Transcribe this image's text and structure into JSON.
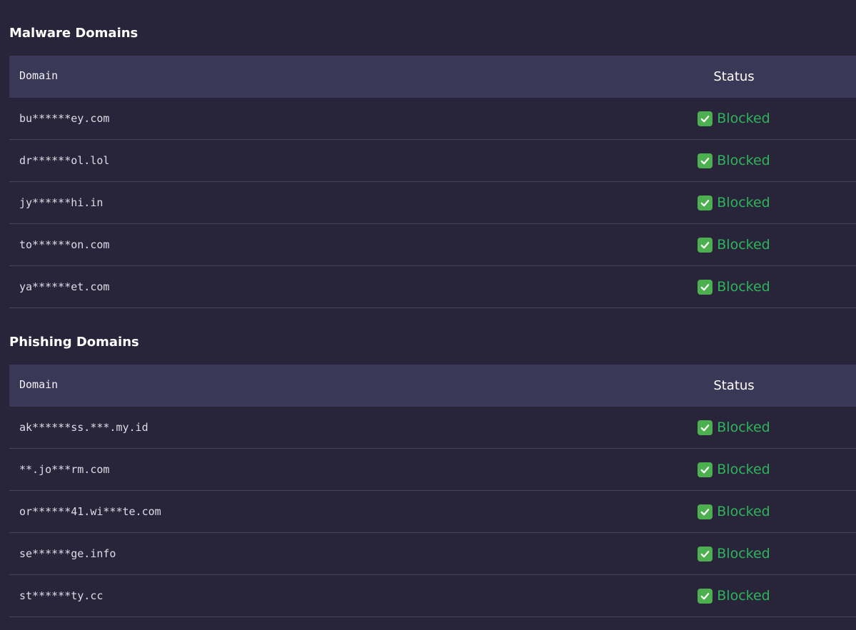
{
  "colors": {
    "background": "#28253a",
    "header_row": "#3b3857",
    "row_divider": "#46435c",
    "status_green": "#2fb35a",
    "check_green": "#4caf50"
  },
  "sections": [
    {
      "title": "Malware Domains",
      "columns": {
        "domain": "Domain",
        "status": "Status"
      },
      "rows": [
        {
          "domain": "bu******ey.com",
          "status": "Blocked",
          "icon": "check-mark-icon"
        },
        {
          "domain": "dr******ol.lol",
          "status": "Blocked",
          "icon": "check-mark-icon"
        },
        {
          "domain": "jy******hi.in",
          "status": "Blocked",
          "icon": "check-mark-icon"
        },
        {
          "domain": "to******on.com",
          "status": "Blocked",
          "icon": "check-mark-icon"
        },
        {
          "domain": "ya******et.com",
          "status": "Blocked",
          "icon": "check-mark-icon"
        }
      ]
    },
    {
      "title": "Phishing Domains",
      "columns": {
        "domain": "Domain",
        "status": "Status"
      },
      "rows": [
        {
          "domain": "ak******ss.***.my.id",
          "status": "Blocked",
          "icon": "check-mark-icon"
        },
        {
          "domain": "**.jo***rm.com",
          "status": "Blocked",
          "icon": "check-mark-icon"
        },
        {
          "domain": "or******41.wi***te.com",
          "status": "Blocked",
          "icon": "check-mark-icon"
        },
        {
          "domain": "se******ge.info",
          "status": "Blocked",
          "icon": "check-mark-icon"
        },
        {
          "domain": "st******ty.cc",
          "status": "Blocked",
          "icon": "check-mark-icon"
        }
      ]
    }
  ]
}
